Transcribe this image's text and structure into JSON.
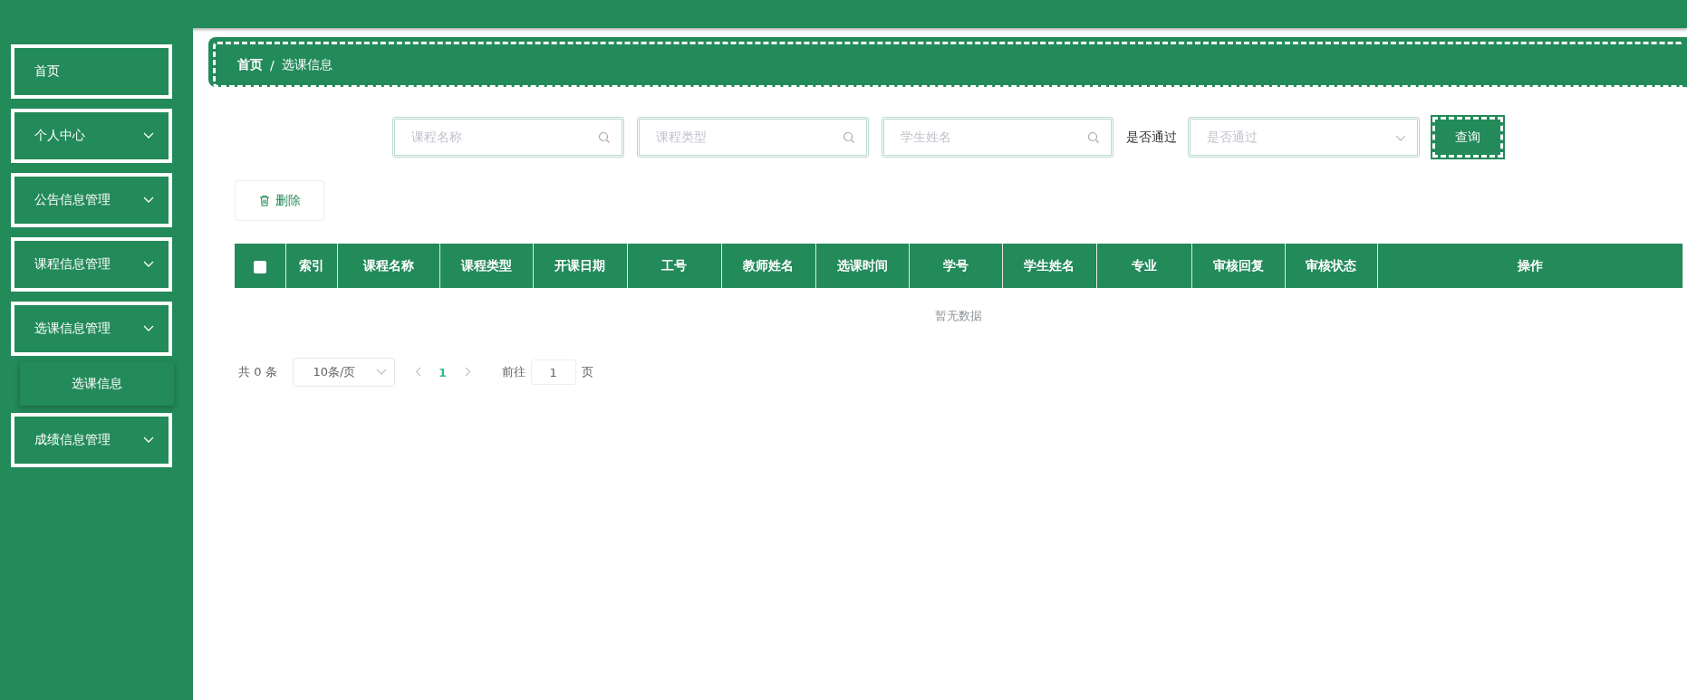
{
  "sidebar": {
    "items": [
      {
        "label": "首页",
        "has_children": false
      },
      {
        "label": "个人中心",
        "has_children": true
      },
      {
        "label": "公告信息管理",
        "has_children": true
      },
      {
        "label": "课程信息管理",
        "has_children": true
      },
      {
        "label": "选课信息管理",
        "has_children": true,
        "children": [
          {
            "label": "选课信息"
          }
        ]
      },
      {
        "label": "成绩信息管理",
        "has_children": true
      }
    ]
  },
  "breadcrumb": [
    "首页",
    "选课信息"
  ],
  "breadcrumb_separator": "/",
  "search": {
    "fields": [
      {
        "kind": "input",
        "placeholder": "课程名称"
      },
      {
        "kind": "input",
        "placeholder": "课程类型"
      },
      {
        "kind": "input",
        "placeholder": "学生姓名"
      },
      {
        "kind": "select",
        "label": "是否通过",
        "placeholder": "是否通过"
      }
    ],
    "button": "查询"
  },
  "delete_button": "删除",
  "table": {
    "select_all": {
      "checked": false
    },
    "columns": [
      "索引",
      "课程名称",
      "课程类型",
      "开课日期",
      "工号",
      "教师姓名",
      "选课时间",
      "学号",
      "学生姓名",
      "专业",
      "审核回复",
      "审核状态",
      "操作"
    ],
    "empty_text": "暂无数据"
  },
  "pagination": {
    "total": "共 0 条",
    "page_size": "10条/页",
    "pages": [
      {
        "label": "1",
        "selected": true
      }
    ],
    "goto_label": "前往",
    "goto_value": "1",
    "goto_suffix": "页"
  }
}
